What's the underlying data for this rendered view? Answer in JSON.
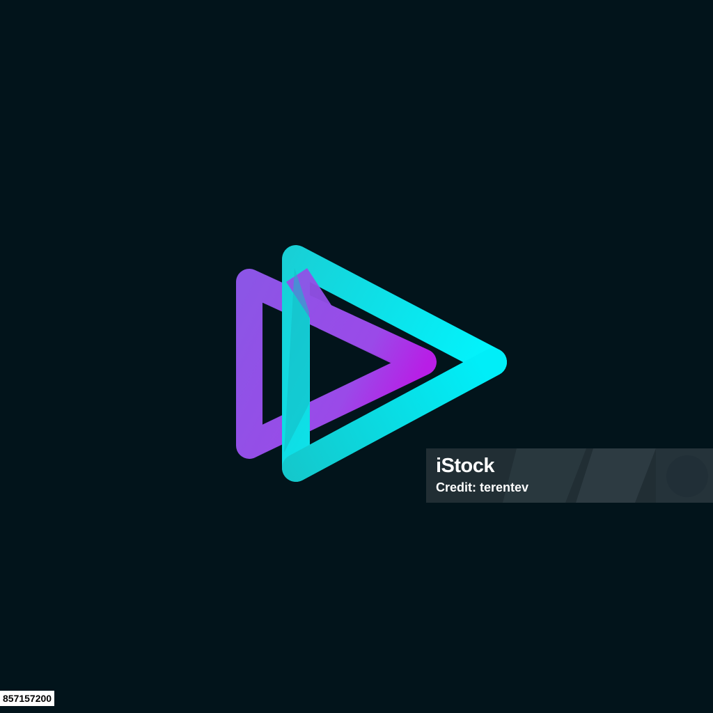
{
  "logo": {
    "icon": "play-icon",
    "colors": {
      "background": "#02141b",
      "purple": "#8b55e8",
      "magenta": "#b21de6",
      "cyan": "#00f2ff",
      "teal": "#17c9cc"
    }
  },
  "watermark": {
    "brand": "iStock",
    "credit": "Credit: terentev"
  },
  "image_id": "857157200"
}
